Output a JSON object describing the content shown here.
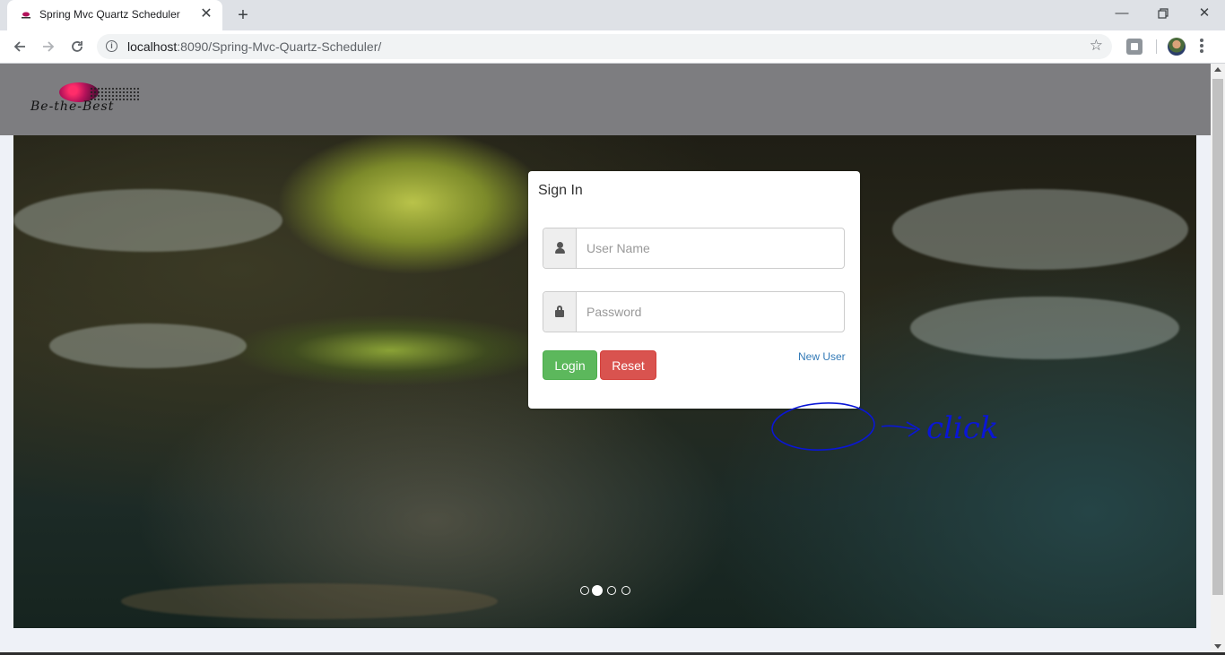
{
  "browser": {
    "tab_title": "Spring Mvc Quartz Scheduler",
    "url_host": "localhost",
    "url_rest": ":8090/Spring-Mvc-Quartz-Scheduler/",
    "icons": [
      "back-icon",
      "forward-icon",
      "reload-icon",
      "info-icon",
      "star-icon",
      "extension-icon",
      "profile-avatar",
      "menu-icon"
    ]
  },
  "header": {
    "logo_text": "Be-the-Best"
  },
  "carousel": {
    "slide_count": 4,
    "active_index": 1
  },
  "signin": {
    "title": "Sign In",
    "username_placeholder": "User Name",
    "password_placeholder": "Password",
    "login_label": "Login",
    "reset_label": "Reset",
    "new_user_label": "New User"
  },
  "annotation": {
    "text": "click",
    "color": "#0a16d6"
  },
  "colors": {
    "header_bg": "#7d7d80",
    "login_btn": "#5cb85c",
    "reset_btn": "#d9534f",
    "link": "#337ab7"
  }
}
